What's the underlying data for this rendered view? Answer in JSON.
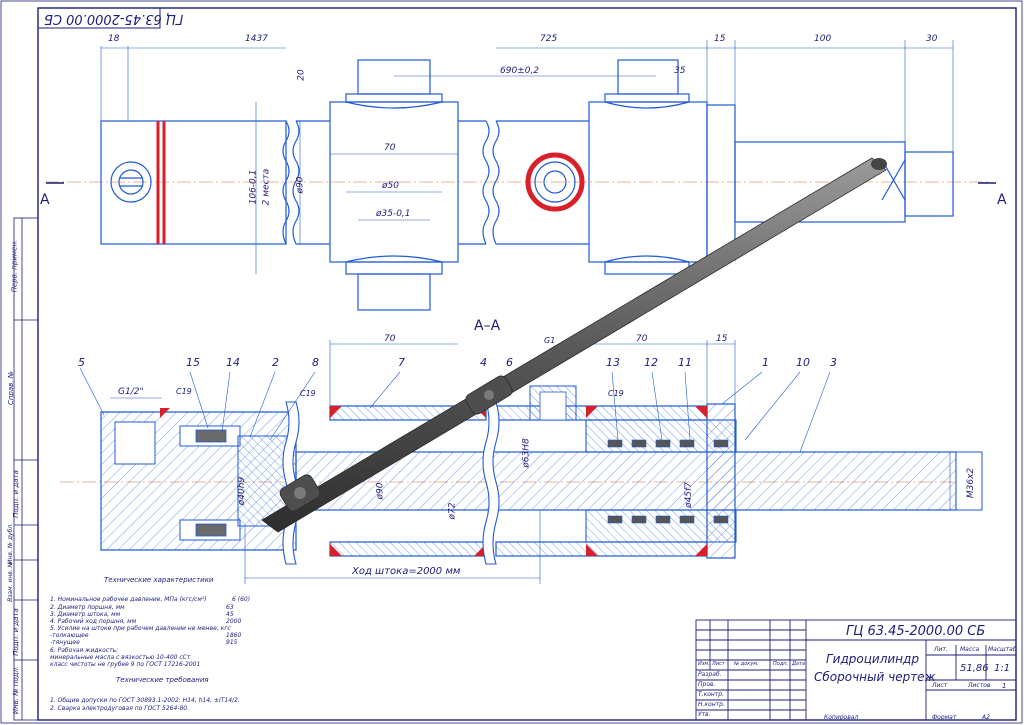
{
  "stamp_code_rotated": "ГЦ 63.45-2000.00 СБ",
  "top_view": {
    "dims": [
      "18",
      "1437",
      "725",
      "15",
      "100",
      "30",
      "20",
      "690±0,2",
      "35",
      "70",
      "ø50",
      "ø35-0,1",
      "ø90",
      "106-0,1",
      "2 места"
    ],
    "section_marks": [
      "A",
      "A"
    ]
  },
  "section_view": {
    "title": "А–А",
    "dims": [
      "70",
      "70",
      "15",
      "G1/2\"",
      "C19",
      "C19",
      "C19",
      "G1",
      "ø40h9",
      "ø90",
      "ø72",
      "ø63H8",
      "ø45f7",
      "M36x2"
    ],
    "stroke_label": "Ход штока=2000 мм",
    "part_numbers": [
      "5",
      "15",
      "14",
      "2",
      "8",
      "7",
      "4",
      "6",
      "13",
      "12",
      "11",
      "1",
      "10",
      "3"
    ]
  },
  "tech_characteristics": {
    "heading": "Технические характеристики",
    "lines": [
      "1. Номинальное рабочее давление, МПа (кгс/см²)",
      "2. Диаметр поршня, мм",
      "3. Диаметр штока, мм",
      "4. Рабочий ход поршня, мм",
      "5. Усилие на штоке при рабочем давлении не менее, кгс",
      "  -толкающее",
      "  -тянущее",
      "6. Рабочая жидкость:",
      "минеральные масла с вязкостью 10-400 сСт",
      "класс чистоты не грубее 9 по ГОСТ 17216-2001"
    ],
    "values": [
      "6 (60)",
      "63",
      "45",
      "2000",
      "",
      "1860",
      "915"
    ]
  },
  "tech_requirements": {
    "heading": "Технические требования",
    "lines": [
      "1. Общие допуски по ГОСТ 30893.1-2002: H14, h14, ±IT14/2.",
      "2. Сварка электродуговая по ГОСТ 5264-80."
    ]
  },
  "side_strip": [
    "Перв. примен.",
    "Справ. №",
    "Подп. и дата",
    "Инв. № дубл.",
    "Взам. инв. №",
    "Подп. и дата",
    "Инв. № подл."
  ],
  "title_block": {
    "doc_code": "ГЦ 63.45-2000.00 СБ",
    "name_line1": "Гидроцилиндр",
    "name_line2": "Сборочный чертеж",
    "col_headers": [
      "Изм.",
      "Лист",
      "№ докум.",
      "Подп.",
      "Дата"
    ],
    "roles": [
      "Разраб.",
      "Пров.",
      "Т.контр.",
      "Н.контр.",
      "Утв."
    ],
    "lit_label": "Лит.",
    "mass_label": "Масса",
    "scale_label": "Масштаб",
    "mass_value": "51,86",
    "scale_value": "1:1",
    "sheet_label": "Лист",
    "sheets_label": "Листов",
    "sheets_value": "1",
    "copied_label": "Копировал",
    "format_label": "Формат",
    "format_value": "A2"
  },
  "colors": {
    "line": "#1e5bd6",
    "text": "#1d1d7a",
    "seal": "#d8202a",
    "rod": "#5a5a5a"
  }
}
